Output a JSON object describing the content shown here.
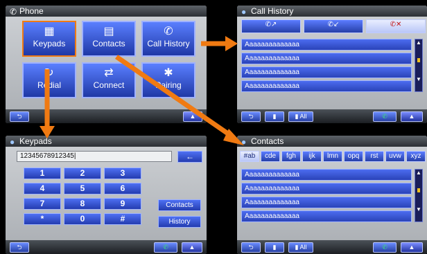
{
  "phone": {
    "title": "Phone",
    "buttons": [
      {
        "label": "Keypads"
      },
      {
        "label": "Contacts"
      },
      {
        "label": "Call History"
      },
      {
        "label": "Redial"
      },
      {
        "label": "Connect"
      },
      {
        "label": "Pairing"
      }
    ]
  },
  "call_history": {
    "title": "Call History",
    "rows": [
      "Aaaaaaaaaaaaaa",
      "Aaaaaaaaaaaaaa",
      "Aaaaaaaaaaaaaa",
      "Aaaaaaaaaaaaaa"
    ],
    "bottom_all_label": "All"
  },
  "keypads": {
    "title": "Keypads",
    "input_value": "12345678912345|",
    "keys": [
      "1",
      "2",
      "3",
      "4",
      "5",
      "6",
      "7",
      "8",
      "9",
      "*",
      "0",
      "#"
    ],
    "side_buttons": [
      "Contacts",
      "History"
    ],
    "backspace_label": "←"
  },
  "contacts": {
    "title": "Contacts",
    "tabs": [
      "#ab",
      "cde",
      "fgh",
      "ijk",
      "lmn",
      "opq",
      "rst",
      "uvw",
      "xyz"
    ],
    "rows": [
      "Aaaaaaaaaaaaaa",
      "Aaaaaaaaaaaaaa",
      "Aaaaaaaaaaaaaa",
      "Aaaaaaaaaaaaaa"
    ],
    "bottom_all_label": "All"
  },
  "colors": {
    "accent": "#f07a12",
    "button_blue": "#3556d8"
  }
}
